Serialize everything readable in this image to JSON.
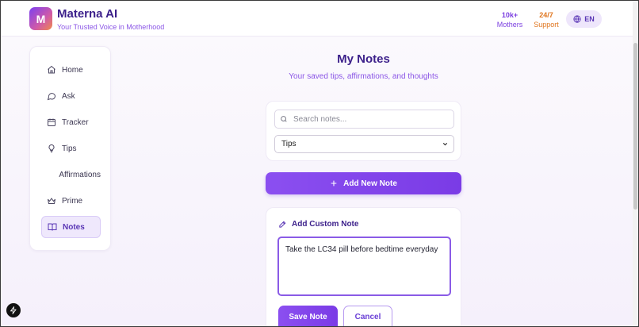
{
  "header": {
    "logo_letter": "M",
    "brand_name": "Materna AI",
    "brand_tagline": "Your Trusted Voice in Motherhood",
    "stats": [
      {
        "value": "10k+",
        "label": "Mothers",
        "color": "#7b3fe0"
      },
      {
        "value": "24/7",
        "label": "Support",
        "color": "#e0761f"
      }
    ],
    "language": {
      "icon": "globe-icon",
      "label": "EN"
    }
  },
  "sidebar": {
    "items": [
      {
        "label": "Home",
        "icon": "home-icon"
      },
      {
        "label": "Ask",
        "icon": "chat-bubble-icon"
      },
      {
        "label": "Tracker",
        "icon": "calendar-icon"
      },
      {
        "label": "Tips",
        "icon": "lightbulb-icon"
      },
      {
        "label": "Affirmations",
        "icon": ""
      },
      {
        "label": "Prime",
        "icon": "crown-icon"
      },
      {
        "label": "Notes",
        "icon": "book-icon",
        "active": true
      }
    ]
  },
  "main": {
    "title": "My Notes",
    "subtitle": "Your saved tips, affirmations, and thoughts",
    "search": {
      "placeholder": "Search notes...",
      "value": ""
    },
    "filter": {
      "selected": "Tips"
    },
    "add_button": "Add New Note",
    "custom_note": {
      "heading": "Add Custom Note",
      "text": "Take the LC34 pill before bedtime everyday",
      "save_label": "Save Note",
      "cancel_label": "Cancel"
    }
  },
  "colors": {
    "accent": "#7a3be6",
    "brand_dark": "#3b1f8a",
    "support_orange": "#e0761f"
  }
}
